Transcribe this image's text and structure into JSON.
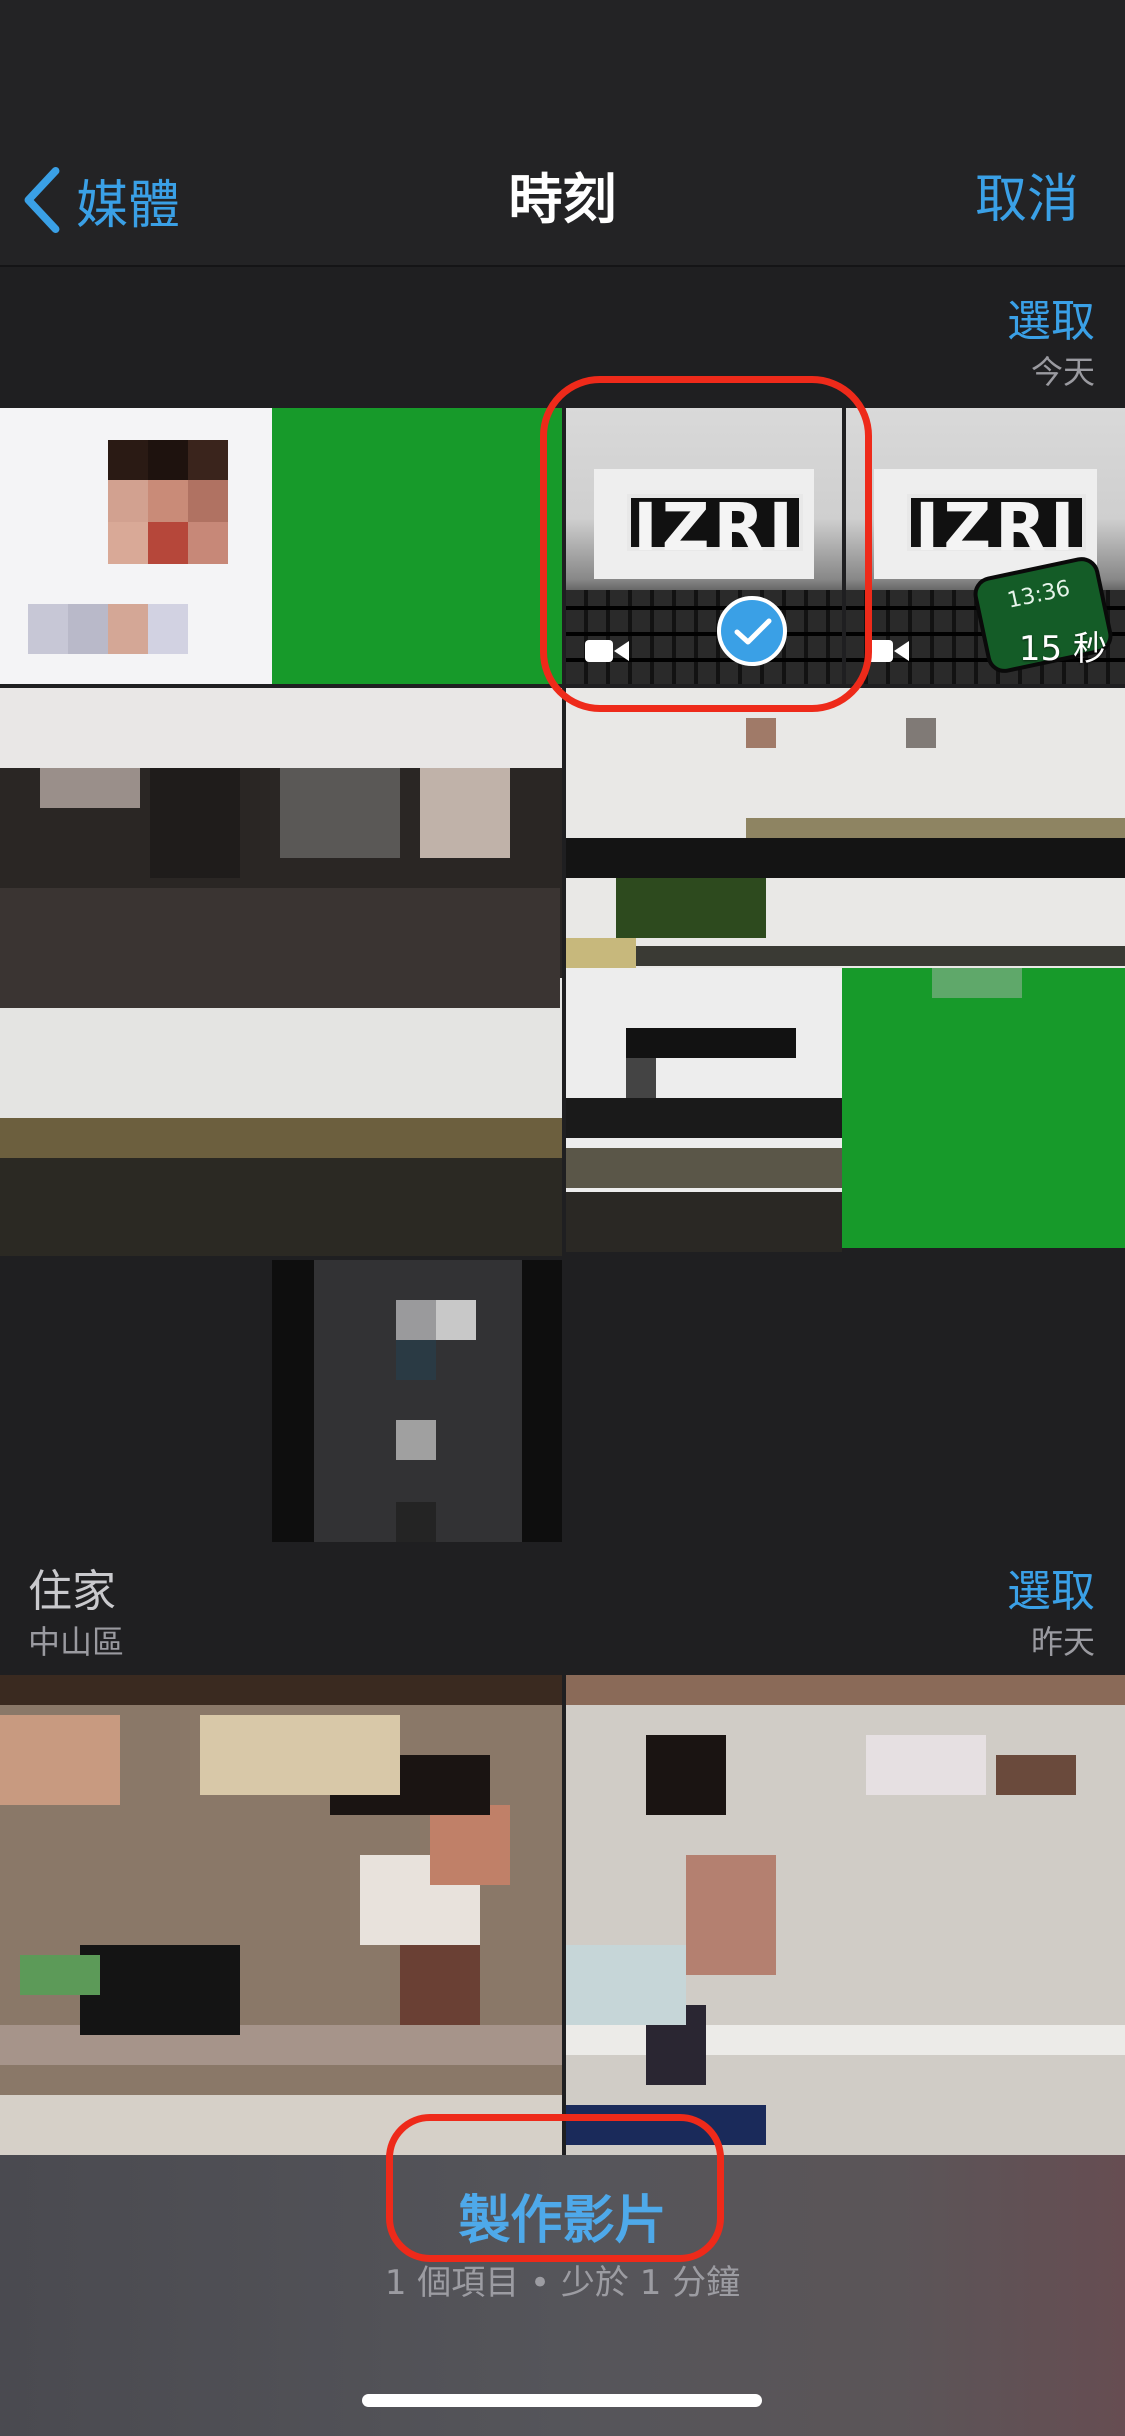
{
  "nav": {
    "back_label": "媒體",
    "title": "時刻",
    "cancel_label": "取消"
  },
  "section_today": {
    "select_label": "選取",
    "date": "今天"
  },
  "video_tiles": [
    {
      "logo": "IZRI",
      "selected": true
    },
    {
      "logo": "IZRI",
      "duration": "15 秒",
      "phone_time": "13:36"
    }
  ],
  "section_home": {
    "title": "住家",
    "subtitle": "中山區",
    "select_label": "選取",
    "date": "昨天"
  },
  "bottom": {
    "make_movie_label": "製作影片",
    "info": "1 個項目 • 少於 1 分鐘"
  },
  "colors": {
    "accent": "#3aa0e6",
    "annotation_red": "#ee2a1a",
    "green_tile": "#179a2a"
  }
}
